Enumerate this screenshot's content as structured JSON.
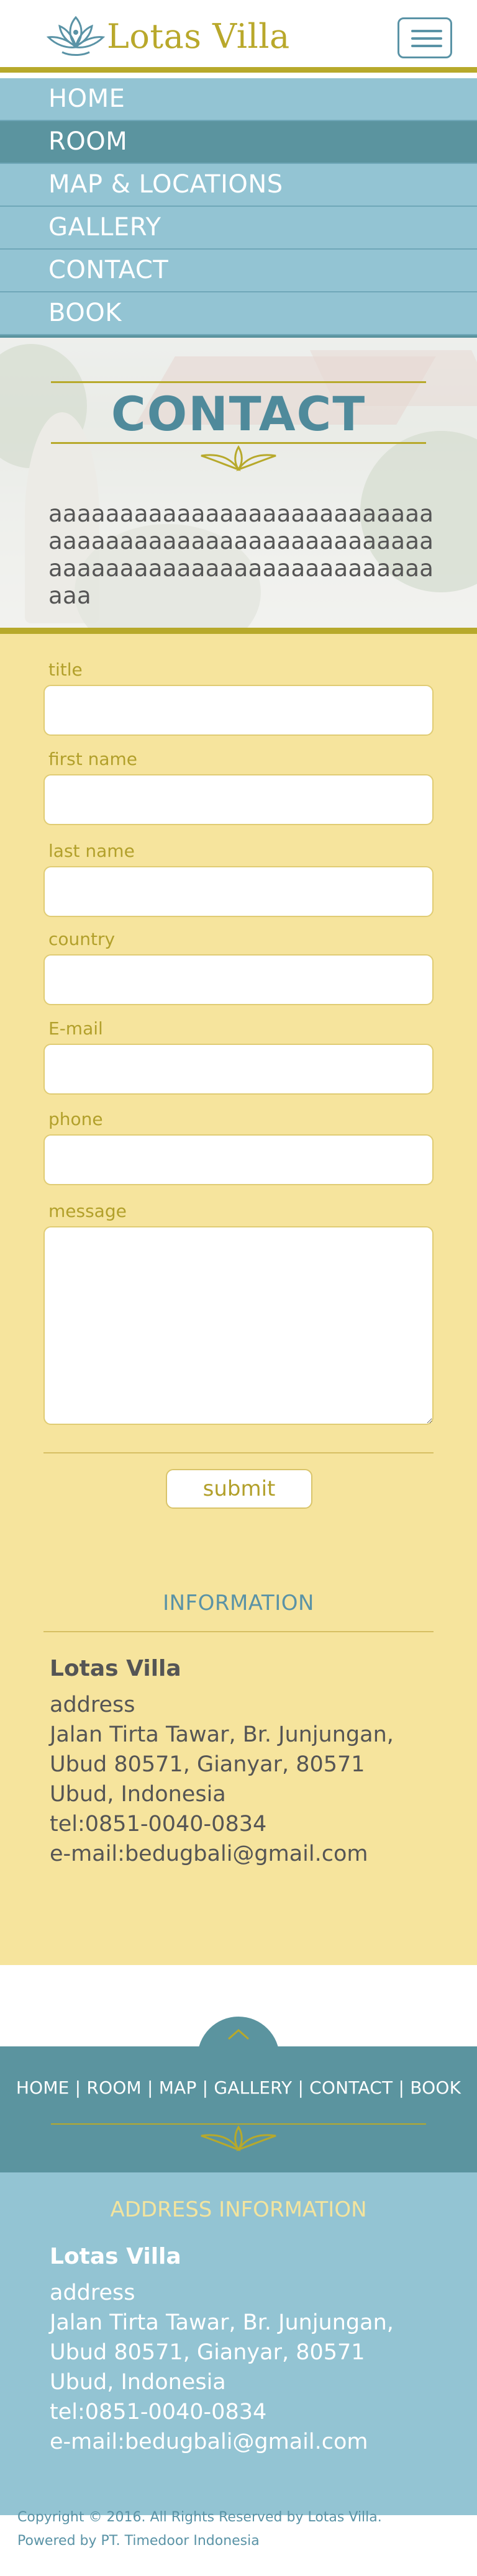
{
  "brand": {
    "name": "Lotas Villa",
    "colors": {
      "gold": "#b7a92b",
      "teal": "#5b949f",
      "light_teal": "#93c4d3",
      "sand": "#f6e49d"
    }
  },
  "header": {
    "logo_icon": "lotus-icon",
    "menu_icon": "hamburger-menu-icon"
  },
  "nav": {
    "items": [
      {
        "label": "HOME",
        "active": false
      },
      {
        "label": "ROOM",
        "active": true
      },
      {
        "label": "MAP &  LOCATIONS",
        "active": false
      },
      {
        "label": "GALLERY",
        "active": false
      },
      {
        "label": "CONTACT",
        "active": false
      },
      {
        "label": "BOOK",
        "active": false
      }
    ]
  },
  "hero": {
    "title": "CONTACT",
    "text": "aaaaaaaaaaaaaaaaaaaaaaaaaaaaaaaaaaaaaaaaaaaaaaaaaaaaaaaaaaaaaaaaaaaaaaaaaaaaaaaaaaaa",
    "ornament_icon": "leaf-ornament-icon"
  },
  "form": {
    "fields": {
      "title": {
        "label": "title",
        "value": ""
      },
      "first_name": {
        "label": "first name",
        "value": ""
      },
      "last_name": {
        "label": "last name",
        "value": ""
      },
      "country": {
        "label": "country",
        "value": ""
      },
      "email": {
        "label": "E-mail",
        "value": ""
      },
      "phone": {
        "label": "phone",
        "value": ""
      },
      "message": {
        "label": "message",
        "value": ""
      }
    },
    "submit_label": "submit"
  },
  "information": {
    "title": "INFORMATION",
    "name": "Lotas Villa",
    "address_label": "address",
    "address": "Jalan Tirta Tawar, Br. Junjungan, Ubud 80571, Gianyar, 80571 Ubud, Indonesia",
    "tel": "tel:0851-0040-0834",
    "email": "e-mail:bedugbali@gmail.com"
  },
  "footer": {
    "links": [
      "HOME",
      "ROOM",
      "MAP",
      "GALLERY ",
      "CONTACT",
      "BOOK"
    ],
    "separator": " | ",
    "up_icon": "chevron-up-icon",
    "address_title": "ADDRESS INFORMATION",
    "name": "Lotas Villa",
    "address_label": "address",
    "address": "Jalan Tirta Tawar, Br. Junjungan, Ubud 80571, Gianyar, 80571 Ubud, Indonesia",
    "tel": "tel:0851-0040-0834",
    "email": "e-mail:bedugbali@gmail.com",
    "copyright_line1": "Copyright © 2016. All Rights Reserved by Lotas Villa.",
    "copyright_line2": "Powered by PT. Timedoor Indonesia"
  }
}
